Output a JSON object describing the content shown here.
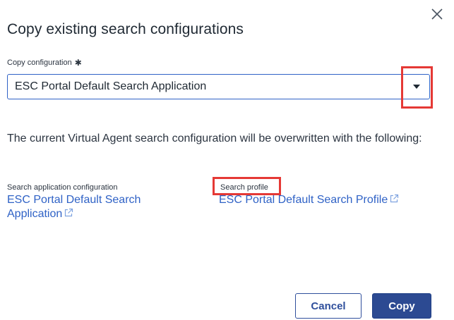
{
  "dialog": {
    "title": "Copy existing search configurations",
    "close_icon": "close-icon"
  },
  "copy_configuration": {
    "label": "Copy configuration",
    "required_marker": "✱",
    "selected_value": "ESC Portal Default Search Application"
  },
  "description": "The current Virtual Agent search configuration will be overwritten with the following:",
  "search_application": {
    "label": "Search application configuration",
    "link_text": "ESC Portal Default Search Application"
  },
  "search_profile": {
    "label": "Search profile",
    "link_text": "ESC Portal Default Search Profile"
  },
  "buttons": {
    "cancel_label": "Cancel",
    "copy_label": "Copy"
  },
  "colors": {
    "accent": "#2f62c6",
    "primary_button": "#2c4a92",
    "highlight": "#e53935"
  }
}
